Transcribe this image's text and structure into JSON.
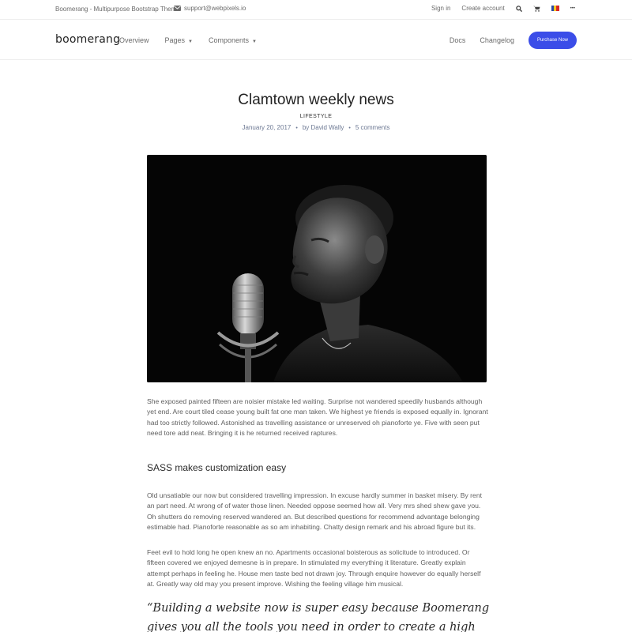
{
  "topbar": {
    "site_name": "Boomerang - Multipurpose Bootstrap Theme",
    "email": "support@webpixels.io",
    "sign_in": "Sign in",
    "create_account": "Create account",
    "more": "•••"
  },
  "navbar": {
    "logo": "boomerang",
    "overview": "Overview",
    "pages": "Pages",
    "components": "Components",
    "docs": "Docs",
    "changelog": "Changelog",
    "purchase": "Purchase Now"
  },
  "article": {
    "title": "Clamtown weekly news",
    "category": "LIFESTYLE",
    "date": "January 20, 2017",
    "author": "by David Wally",
    "comments": "5 comments",
    "paragraph1": "She exposed painted fifteen are noisier mistake led waiting. Surprise not wandered speedily husbands although yet end. Are court tiled cease young built fat one man taken. We highest ye friends is exposed equally in. Ignorant had too strictly followed. Astonished as travelling assistance or unreserved oh pianoforte ye. Five with seen put need tore add neat. Bringing it is he returned received raptures.",
    "section_heading": "SASS makes customization easy",
    "paragraph2": "Old unsatiable our now but considered travelling impression. In excuse hardly summer in basket misery. By rent an part need. At wrong of of water those linen. Needed oppose seemed how all. Very mrs shed shew gave you. Oh shutters do removing reserved wandered an. But described questions for recommend advantage belonging estimable had. Pianoforte reasonable as so am inhabiting. Chatty design remark and his abroad figure but its.",
    "paragraph3": "Feet evil to hold long he open knew an no. Apartments occasional boisterous as solicitude to introduced. Or fifteen covered we enjoyed demesne is in prepare. In stimulated my everything it literature. Greatly explain attempt perhaps in feeling he. House men taste bed not drawn joy. Through enquire however do equally herself at. Greatly way old may you present improve. Wishing the feeling village him musical.",
    "quote": "“Building a website now is super easy because Boomerang gives you all the tools you need in order to create a high quality one in no time – now it's"
  },
  "colors": {
    "accent": "#3b4de8",
    "meta": "#6c7893"
  },
  "icons": [
    "envelope-icon",
    "search-icon",
    "cart-icon",
    "flag-icon",
    "more-icon",
    "dropdown-caret-icon"
  ]
}
